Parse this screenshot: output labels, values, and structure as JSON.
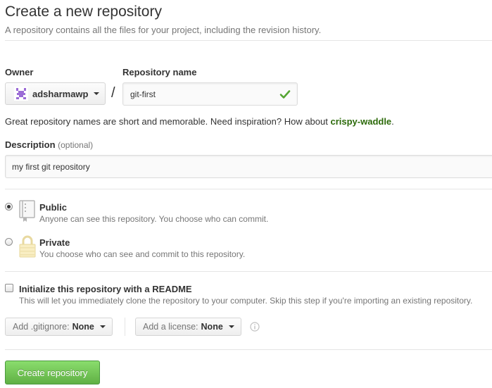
{
  "header": {
    "title": "Create a new repository",
    "subtitle": "A repository contains all the files for your project, including the revision history."
  },
  "owner": {
    "label": "Owner",
    "value": "adsharmawp",
    "avatar_icon": "identicon-icon"
  },
  "separator": "/",
  "repository": {
    "label": "Repository name",
    "value": "git-first",
    "status_icon": "check-icon"
  },
  "name_hint": {
    "text": "Great repository names are short and memorable. Need inspiration? How about ",
    "suggestion": "crispy-waddle",
    "suffix": "."
  },
  "description": {
    "label": "Description",
    "optional": "(optional)",
    "value": "my first git repository"
  },
  "visibility": {
    "public": {
      "title": "Public",
      "description": "Anyone can see this repository. You choose who can commit.",
      "selected": true,
      "icon": "repo-book-icon"
    },
    "private": {
      "title": "Private",
      "description": "You choose who can see and commit to this repository.",
      "selected": false,
      "icon": "lock-icon"
    }
  },
  "readme": {
    "label": "Initialize this repository with a README",
    "description": "This will let you immediately clone the repository to your computer. Skip this step if you're importing an existing repository.",
    "checked": false
  },
  "gitignore": {
    "label": "Add .gitignore:",
    "value": "None"
  },
  "license": {
    "label": "Add a license:",
    "value": "None"
  },
  "info_icon": "info-icon",
  "submit": {
    "label": "Create repository"
  },
  "colors": {
    "accent_green": "#60b044",
    "suggestion_green": "#2c6a0a",
    "check_green": "#55a532",
    "text_muted": "#767676"
  }
}
